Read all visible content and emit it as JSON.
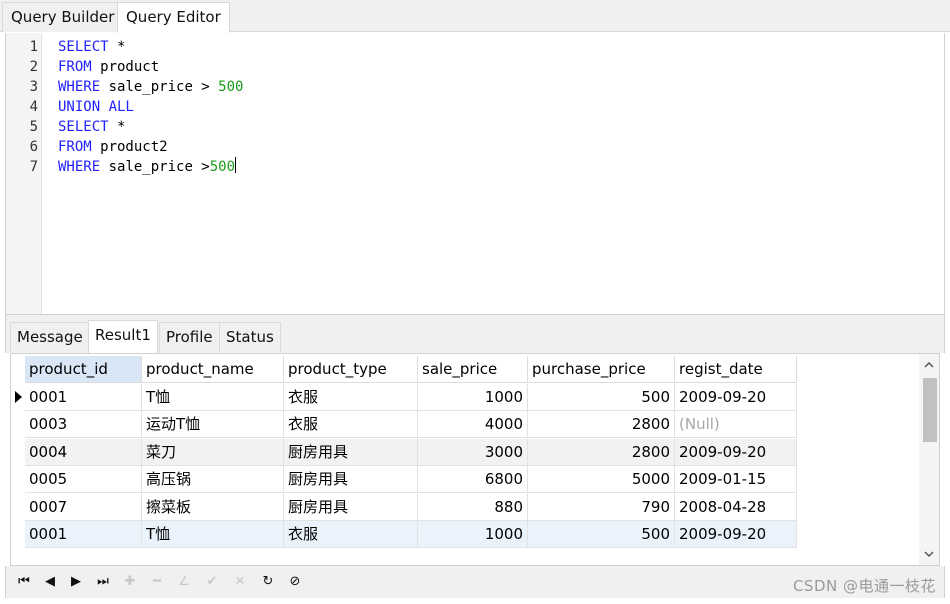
{
  "top_tabs": [
    "Query Builder",
    "Query Editor"
  ],
  "editor": {
    "lines": [
      {
        "num": "1",
        "parts": [
          {
            "t": "SELECT",
            "c": "kw"
          },
          {
            "t": " *",
            "c": ""
          }
        ]
      },
      {
        "num": "2",
        "parts": [
          {
            "t": "FROM",
            "c": "kw"
          },
          {
            "t": " product",
            "c": ""
          }
        ]
      },
      {
        "num": "3",
        "parts": [
          {
            "t": "WHERE",
            "c": "kw"
          },
          {
            "t": " sale_price > ",
            "c": ""
          },
          {
            "t": "500",
            "c": "num"
          }
        ]
      },
      {
        "num": "4",
        "parts": [
          {
            "t": "UNION ALL",
            "c": "kw"
          }
        ]
      },
      {
        "num": "5",
        "parts": [
          {
            "t": "SELECT",
            "c": "kw"
          },
          {
            "t": " *",
            "c": ""
          }
        ]
      },
      {
        "num": "6",
        "parts": [
          {
            "t": "FROM",
            "c": "kw"
          },
          {
            "t": " product2",
            "c": ""
          }
        ]
      },
      {
        "num": "7",
        "parts": [
          {
            "t": "WHERE",
            "c": "kw"
          },
          {
            "t": " sale_price >",
            "c": ""
          },
          {
            "t": "500",
            "c": "num"
          }
        ]
      }
    ],
    "colors": {
      "keyword": "#1f1fff",
      "number": "#1a9c1a"
    }
  },
  "bottom_tabs": [
    "Message",
    "Result1",
    "Profile",
    "Status"
  ],
  "grid": {
    "columns": [
      "product_id",
      "product_name",
      "product_type",
      "sale_price",
      "purchase_price",
      "regist_date"
    ],
    "rows": [
      [
        "0001",
        "T恤",
        "衣服",
        "1000",
        "500",
        "2009-09-20"
      ],
      [
        "0003",
        "运动T恤",
        "衣服",
        "4000",
        "2800",
        "(Null)"
      ],
      [
        "0004",
        "菜刀",
        "厨房用具",
        "3000",
        "2800",
        "2009-09-20"
      ],
      [
        "0005",
        "高压锅",
        "厨房用具",
        "6800",
        "5000",
        "2009-01-15"
      ],
      [
        "0007",
        "擦菜板",
        "厨房用具",
        "880",
        "790",
        "2008-04-28"
      ],
      [
        "0001",
        "T恤",
        "衣服",
        "1000",
        "500",
        "2009-09-20"
      ]
    ],
    "null_text": "(Null)"
  },
  "toolbar": {
    "buttons": [
      {
        "name": "first-record-button",
        "glyph": "⏮",
        "enabled": true
      },
      {
        "name": "prior-record-button",
        "glyph": "◀",
        "enabled": true
      },
      {
        "name": "next-record-button",
        "glyph": "▶",
        "enabled": true
      },
      {
        "name": "last-record-button",
        "glyph": "⏭",
        "enabled": true
      },
      {
        "name": "insert-record-button",
        "glyph": "✚",
        "enabled": false
      },
      {
        "name": "delete-record-button",
        "glyph": "━",
        "enabled": false
      },
      {
        "name": "edit-record-button",
        "glyph": "∠",
        "enabled": false
      },
      {
        "name": "post-record-button",
        "glyph": "✔",
        "enabled": false
      },
      {
        "name": "cancel-record-button",
        "glyph": "✕",
        "enabled": false
      },
      {
        "name": "refresh-button",
        "glyph": "↻",
        "enabled": true
      },
      {
        "name": "stop-button",
        "glyph": "⊘",
        "enabled": true
      }
    ]
  },
  "watermark": "CSDN @电通一枝花"
}
